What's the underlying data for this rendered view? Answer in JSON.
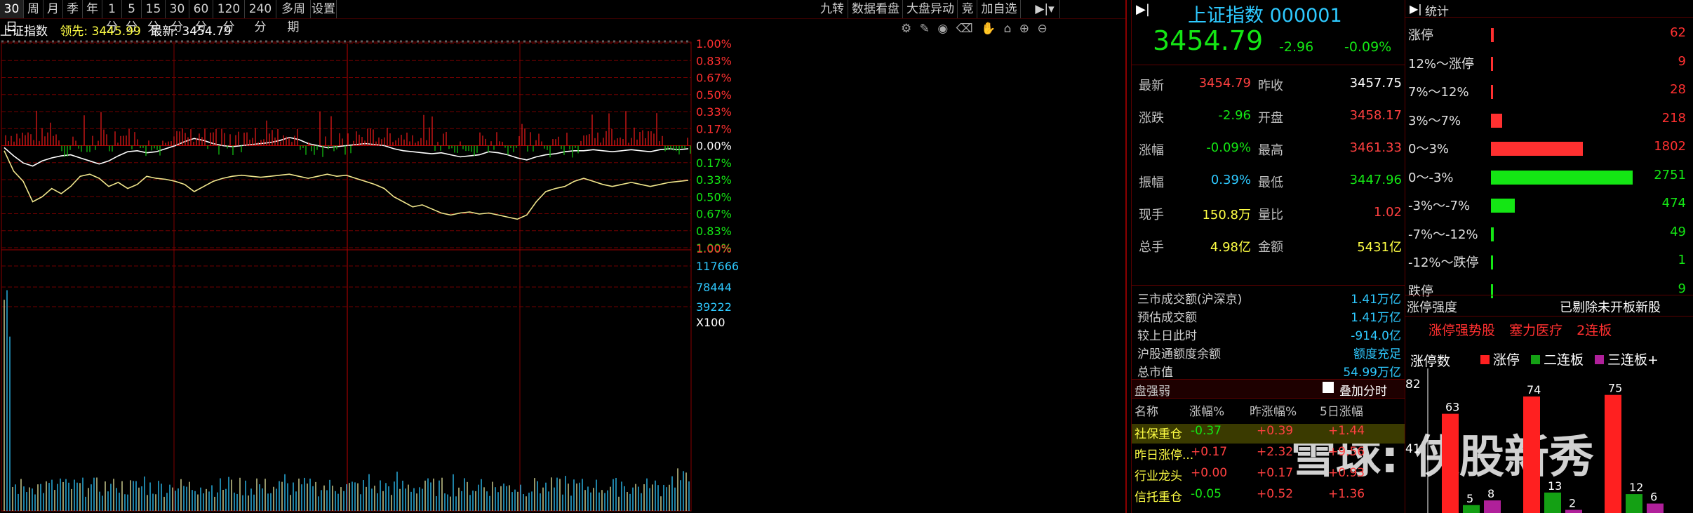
{
  "toolbar": {
    "periods": [
      "30日",
      "周",
      "月",
      "季",
      "年",
      "1分",
      "5分",
      "15分",
      "30分",
      "60分",
      "120分",
      "240分",
      "多周期",
      "设置"
    ],
    "right_buttons": [
      "九转",
      "数据看盘",
      "大盘异动",
      "竞",
      "加自选"
    ]
  },
  "chart_header": {
    "name": "上证指数",
    "leader_label": "领先:",
    "leader_value": "3445.99",
    "latest_label": "最新:",
    "latest_value": "3454.79"
  },
  "axis": {
    "pct_top": [
      "1.00%",
      "0.83%",
      "0.67%",
      "0.50%",
      "0.33%",
      "0.17%",
      "0.00%",
      "0.17%",
      "0.33%",
      "0.50%",
      "0.67%",
      "0.83%",
      "1.00%"
    ],
    "vol_labels": [
      "117666",
      "78444",
      "39222",
      "X100"
    ]
  },
  "chart_data": {
    "type": "line",
    "ylim_pct": [
      -1.0,
      1.0
    ],
    "series": [
      {
        "name": "最新",
        "color": "#ffffff",
        "values": [
          -0.02,
          -0.1,
          -0.17,
          -0.2,
          -0.15,
          -0.12,
          -0.1,
          -0.09,
          -0.12,
          -0.15,
          -0.18,
          -0.15,
          -0.1,
          -0.06,
          -0.05,
          -0.07,
          -0.06,
          -0.03,
          0.0,
          0.04,
          0.07,
          0.05,
          0.02,
          0.0,
          -0.01,
          0.0,
          0.01,
          0.02,
          0.03,
          0.05,
          0.08,
          0.06,
          0.02,
          0.0,
          -0.02,
          -0.01,
          0.0,
          0.01,
          0.02,
          0.01,
          0.0,
          -0.03,
          -0.05,
          -0.06,
          -0.07,
          -0.08,
          -0.07,
          -0.09,
          -0.11,
          -0.1,
          -0.09,
          -0.06,
          -0.07,
          -0.09,
          -0.12,
          -0.14,
          -0.11,
          -0.09,
          -0.08,
          -0.06,
          -0.05,
          -0.05,
          -0.04,
          -0.05,
          -0.06,
          -0.05,
          -0.04,
          -0.05,
          -0.06,
          -0.04,
          -0.03,
          -0.04,
          -0.03
        ]
      },
      {
        "name": "领先",
        "color": "#f0e68c",
        "values": [
          -0.05,
          -0.25,
          -0.35,
          -0.55,
          -0.5,
          -0.42,
          -0.47,
          -0.4,
          -0.3,
          -0.28,
          -0.32,
          -0.4,
          -0.36,
          -0.42,
          -0.38,
          -0.3,
          -0.32,
          -0.33,
          -0.35,
          -0.38,
          -0.45,
          -0.4,
          -0.35,
          -0.32,
          -0.3,
          -0.29,
          -0.3,
          -0.31,
          -0.3,
          -0.29,
          -0.28,
          -0.3,
          -0.32,
          -0.3,
          -0.28,
          -0.3,
          -0.29,
          -0.32,
          -0.35,
          -0.38,
          -0.42,
          -0.5,
          -0.55,
          -0.6,
          -0.58,
          -0.62,
          -0.66,
          -0.68,
          -0.66,
          -0.65,
          -0.67,
          -0.66,
          -0.68,
          -0.7,
          -0.72,
          -0.68,
          -0.55,
          -0.45,
          -0.42,
          -0.4,
          -0.35,
          -0.32,
          -0.35,
          -0.38,
          -0.4,
          -0.38,
          -0.36,
          -0.38,
          -0.4,
          -0.38,
          -0.36,
          -0.35,
          -0.34
        ]
      }
    ]
  },
  "quote": {
    "title": "上证指数",
    "code": "000001",
    "price": "3454.79",
    "change": "-2.96",
    "change_pct": "-0.09%",
    "rows": [
      {
        "l1": "最新",
        "v1": "3454.79",
        "c1": "red",
        "l2": "昨收",
        "v2": "3457.75",
        "c2": "white"
      },
      {
        "l1": "涨跌",
        "v1": "-2.96",
        "c1": "green",
        "l2": "开盘",
        "v2": "3458.17",
        "c2": "red"
      },
      {
        "l1": "涨幅",
        "v1": "-0.09%",
        "c1": "green",
        "l2": "最高",
        "v2": "3461.33",
        "c2": "red"
      },
      {
        "l1": "振幅",
        "v1": "0.39%",
        "c1": "cyan",
        "l2": "最低",
        "v2": "3447.96",
        "c2": "green"
      },
      {
        "l1": "现手",
        "v1": "150.8万",
        "c1": "yellow",
        "l2": "量比",
        "v2": "1.02",
        "c2": "red"
      },
      {
        "l1": "总手",
        "v1": "4.98亿",
        "c1": "yellow",
        "l2": "金额",
        "v2": "5431亿",
        "c2": "yellow"
      }
    ],
    "market": [
      {
        "label": "三市成交额(沪深京)",
        "value": "1.41万亿"
      },
      {
        "label": "预估成交额",
        "value": "1.41万亿"
      },
      {
        "label": "较上日此时",
        "value": "-914.0亿"
      },
      {
        "label": "沪股通额度余额",
        "value": "额度充足"
      },
      {
        "label": "总市值",
        "value": "54.99万亿"
      }
    ],
    "strength_title": "盘强弱",
    "overlay_label": "叠加分时",
    "strength_headers": [
      "名称",
      "涨幅%",
      "昨涨幅%",
      "5日涨幅"
    ],
    "strength_rows": [
      {
        "name": "社保重仓",
        "a": "-0.37",
        "b": "+0.39",
        "c": "+1.44"
      },
      {
        "name": "昨日涨停...",
        "a": "+0.17",
        "b": "+2.32",
        "c": "+9.56"
      },
      {
        "name": "行业龙头",
        "a": "+0.00",
        "b": "+0.17",
        "c": "+0.93"
      },
      {
        "name": "信托重仓",
        "a": "-0.05",
        "b": "+0.52",
        "c": "+1.36"
      }
    ]
  },
  "limit_stats": {
    "title": "统计",
    "rows": [
      {
        "label": "涨停",
        "value": "62",
        "color": "#ff3030",
        "frac": 0.02
      },
      {
        "label": "12%～涨停",
        "value": "9",
        "color": "#ff3030",
        "frac": 0.005
      },
      {
        "label": "7%～12%",
        "value": "28",
        "color": "#ff3030",
        "frac": 0.01
      },
      {
        "label": "3%～7%",
        "value": "218",
        "color": "#ff3030",
        "frac": 0.08
      },
      {
        "label": "0～3%",
        "value": "1802",
        "color": "#ff3030",
        "frac": 0.65
      },
      {
        "label": "0～-3%",
        "value": "2751",
        "color": "#14e614",
        "frac": 1.0
      },
      {
        "label": "-3%～-7%",
        "value": "474",
        "color": "#14e614",
        "frac": 0.17
      },
      {
        "label": "-7%～-12%",
        "value": "49",
        "color": "#14e614",
        "frac": 0.02
      },
      {
        "label": "-12%～跌停",
        "value": "1",
        "color": "#14e614",
        "frac": 0.003
      },
      {
        "label": "跌停",
        "value": "9",
        "color": "#14e614",
        "frac": 0.005
      }
    ],
    "strength_title": "涨停强度",
    "strength_note": "已剔除未开板新股",
    "tags": [
      "涨停强势股",
      "塞力医疗",
      "2连板"
    ],
    "board_title": "涨停数",
    "legend": [
      {
        "label": "涨停",
        "color": "#ff2020"
      },
      {
        "label": "二连板",
        "color": "#14a014"
      },
      {
        "label": "三连板+",
        "color": "#b0209a"
      }
    ],
    "y_labels": [
      "82",
      "41"
    ],
    "boards": [
      {
        "limit": 63,
        "two": 5,
        "three": 8
      },
      {
        "limit": 74,
        "two": 13,
        "three": 2
      },
      {
        "limit": 75,
        "two": 12,
        "three": 6
      }
    ]
  },
  "watermark": "雪球: 侠股新秀"
}
